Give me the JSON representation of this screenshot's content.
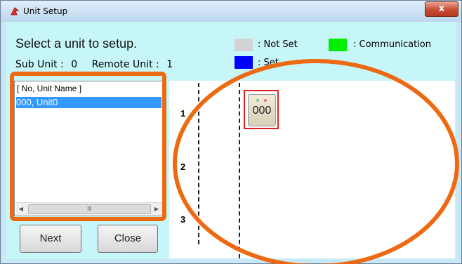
{
  "window": {
    "title": "Unit Setup",
    "close_label": "x",
    "app_icon": "setup-app-icon"
  },
  "header": {
    "prompt": "Select a unit to setup.",
    "sub_unit_label": "Sub Unit :",
    "sub_unit_value": "0",
    "remote_unit_label": "Remote Unit :",
    "remote_unit_value": "1"
  },
  "legend": {
    "not_set": {
      "label": ": Not Set",
      "color": "#d3d3d3"
    },
    "communication": {
      "label": ": Communication",
      "color": "#00ee00"
    },
    "set": {
      "label": ": Set",
      "color": "#0000ff"
    }
  },
  "unit_list": {
    "header": "[ No, Unit Name ]",
    "items": [
      {
        "label": "000, Unit0",
        "selected": true
      }
    ],
    "scroll_left": "◀",
    "scroll_right": "▶",
    "scroll_thumb": "III"
  },
  "buttons": {
    "next": "Next",
    "close": "Close"
  },
  "layout_view": {
    "row_labels": [
      "1",
      "2",
      "3"
    ],
    "units": [
      {
        "number": "000",
        "selected": true
      }
    ]
  },
  "annotation": {
    "color": "#ee6a12"
  }
}
